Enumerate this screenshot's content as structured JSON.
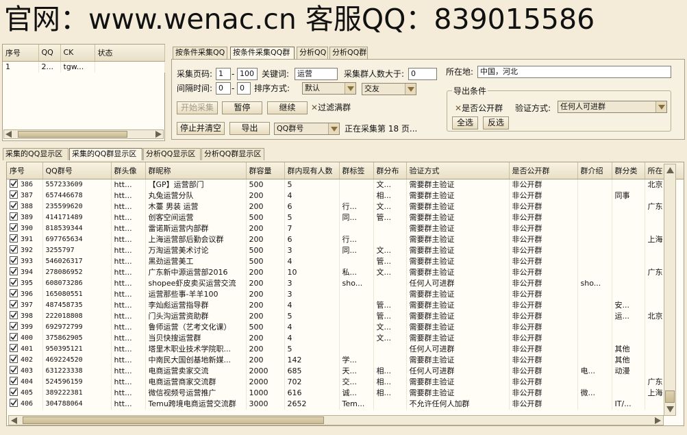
{
  "banner": "官网：www.wenac.cn  客服QQ：839015586",
  "account_list": {
    "headers": [
      "序号",
      "QQ",
      "CK",
      "状态"
    ],
    "rows": [
      [
        "1",
        "2...",
        "tgw...",
        ""
      ]
    ]
  },
  "top_tabs": [
    "按条件采集QQ",
    "按条件采集QQ群",
    "分析QQ",
    "分析QQ群"
  ],
  "form": {
    "page_label": "采集页码:",
    "page_from": "1",
    "page_to": "100",
    "keyword_label": "关键词:",
    "keyword": "运营",
    "member_gt_label": "采集群人数大于:",
    "member_gt": "0",
    "location_label": "所在地:",
    "location": "中国，河北",
    "interval_label": "间隔时间:",
    "interval_from": "0",
    "interval_to": "0",
    "sort_label": "排序方式:",
    "sort_value": "默认",
    "category_value": "交友",
    "start_btn": "开始采集",
    "pause_btn": "暂停",
    "continue_btn": "继续",
    "filter_full": "过滤满群",
    "stop_btn": "停止并清空",
    "export_btn": "导出",
    "export_type": "QQ群号",
    "status": "正在采集第 18 页..."
  },
  "export": {
    "legend": "导出条件",
    "public_label": "是否公开群",
    "verify_label": "验证方式:",
    "verify_value": "任何人可进群",
    "select_all": "全选",
    "invert": "反选"
  },
  "view_tabs": [
    "采集的QQ显示区",
    "采集的QQ群显示区",
    "分析QQ显示区",
    "分析QQ群显示区"
  ],
  "table": {
    "headers": [
      "序号",
      "QQ群号",
      "群头像",
      "群昵称",
      "群容量",
      "群内现有人数",
      "群标签",
      "群分布",
      "验证方式",
      "是否公开群",
      "群介绍",
      "群分类",
      "所在"
    ],
    "rows": [
      [
        "386",
        "557233609",
        "htt...",
        "【GP】运营部门",
        "500",
        "5",
        "",
        "文...",
        "需要群主验证",
        "非公开群",
        "",
        "",
        "北京"
      ],
      [
        "387",
        "657446678",
        "htt...",
        "丸兔运营分队",
        "200",
        "4",
        "",
        "相...",
        "需要群主验证",
        "非公开群",
        "",
        "同事",
        ""
      ],
      [
        "388",
        "235599620",
        "htt...",
        "木薹 男装 运营",
        "200",
        "6",
        "行...",
        "文...",
        "需要群主验证",
        "非公开群",
        "",
        "",
        "广东"
      ],
      [
        "389",
        "414171489",
        "htt...",
        "创客空间运营",
        "500",
        "5",
        "同...",
        "管...",
        "需要群主验证",
        "非公开群",
        "",
        "",
        ""
      ],
      [
        "390",
        "818539344",
        "htt...",
        "雷诺斯运营内部群",
        "200",
        "7",
        "",
        "",
        "需要群主验证",
        "非公开群",
        "",
        "",
        ""
      ],
      [
        "391",
        "697765634",
        "htt...",
        "上海运营部后勤会议群",
        "200",
        "6",
        "行...",
        "",
        "需要群主验证",
        "非公开群",
        "",
        "",
        "上海"
      ],
      [
        "392",
        "3255797",
        "htt...",
        "万淘运营美术讨论",
        "500",
        "3",
        "同...",
        "文...",
        "需要群主验证",
        "非公开群",
        "",
        "",
        ""
      ],
      [
        "393",
        "546026317",
        "htt...",
        "黑劲运营美工",
        "500",
        "4",
        "",
        "管...",
        "需要群主验证",
        "非公开群",
        "",
        "",
        ""
      ],
      [
        "394",
        "278086952",
        "htt...",
        "广东新中源运营部2016",
        "200",
        "10",
        "私...",
        "文...",
        "需要群主验证",
        "非公开群",
        "",
        "",
        "广东"
      ],
      [
        "395",
        "608073286",
        "htt...",
        "shopee虾皮卖买运营交流",
        "200",
        "3",
        "sho...",
        "",
        "任何人可进群",
        "非公开群",
        "sho...",
        "",
        ""
      ],
      [
        "396",
        "165080551",
        "htt...",
        "运营那些事-羊羊100",
        "200",
        "3",
        "",
        "",
        "需要群主验证",
        "非公开群",
        "",
        "",
        ""
      ],
      [
        "397",
        "487458735",
        "htt...",
        "李灿彪运营指导群",
        "200",
        "4",
        "",
        "管...",
        "需要群主验证",
        "非公开群",
        "",
        "安...",
        ""
      ],
      [
        "398",
        "222018808",
        "htt...",
        "门头沟运营资助群",
        "200",
        "5",
        "",
        "管...",
        "需要群主验证",
        "非公开群",
        "",
        "运...",
        "北京"
      ],
      [
        "399",
        "692972799",
        "htt...",
        "鲁师运营（艺考文化课）",
        "500",
        "4",
        "",
        "文...",
        "需要群主验证",
        "非公开群",
        "",
        "",
        ""
      ],
      [
        "400",
        "375862905",
        "htt...",
        "当贝快搜运营群",
        "200",
        "4",
        "",
        "文...",
        "需要群主验证",
        "非公开群",
        "",
        "",
        ""
      ],
      [
        "401",
        "950395121",
        "htt...",
        "塔里木职业技术学院职...",
        "200",
        "5",
        "",
        "",
        "任何人可进群",
        "非公开群",
        "",
        "其他",
        ""
      ],
      [
        "402",
        "469224520",
        "htt...",
        "中南民大国创基地新媒...",
        "200",
        "142",
        "学...",
        "",
        "需要群主验证",
        "非公开群",
        "",
        "其他",
        ""
      ],
      [
        "403",
        "631223338",
        "htt...",
        "电商运营卖家交流",
        "2000",
        "685",
        "天...",
        "相...",
        "任何人可进群",
        "非公开群",
        "电...",
        "动漫",
        ""
      ],
      [
        "404",
        "524596159",
        "htt...",
        "电商运营商家交流群",
        "2000",
        "702",
        "交...",
        "相...",
        "需要群主验证",
        "非公开群",
        "",
        "",
        "广东"
      ],
      [
        "405",
        "389222381",
        "htt...",
        "微信视频号运营推广",
        "1000",
        "616",
        "诚...",
        "相...",
        "需要群主验证",
        "非公开群",
        "微...",
        "",
        "上海"
      ],
      [
        "406",
        "304788064",
        "htt...",
        "Temu跨境电商运营交流群",
        "3000",
        "2652",
        "Tem...",
        "",
        "不允许任何人加群",
        "非公开群",
        "",
        "IT/...",
        ""
      ]
    ]
  },
  "colors": {
    "background": "#f4ecd9",
    "panel": "#fffdf6",
    "border": "#a89f85",
    "button": "#e8dcbe"
  },
  "icons": [
    "checkbox-icon",
    "dropdown-arrow-icon",
    "scroll-left-icon",
    "scroll-right-icon",
    "scroll-up-icon",
    "scroll-down-icon",
    "x-mark-icon"
  ]
}
